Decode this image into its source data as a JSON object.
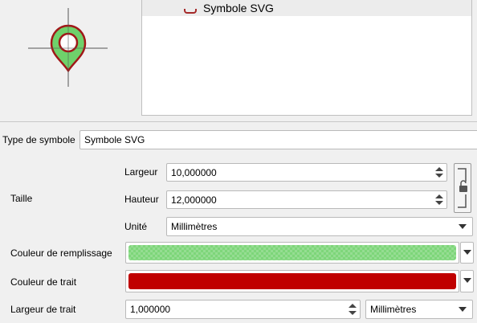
{
  "symbol_list": {
    "items": [
      {
        "label": "Symbole SVG"
      }
    ]
  },
  "form": {
    "symbol_type": {
      "label": "Type de symbole",
      "value": "Symbole SVG"
    },
    "size_group_label": "Taille",
    "width": {
      "label": "Largeur",
      "value": "10,000000"
    },
    "height": {
      "label": "Hauteur",
      "value": "12,000000"
    },
    "unit": {
      "label": "Unité",
      "value": "Millimètres"
    },
    "fill_color": {
      "label": "Couleur de remplissage",
      "color": "#7ed67a"
    },
    "stroke_color": {
      "label": "Couleur de trait",
      "color": "#c00000"
    },
    "stroke_width": {
      "label": "Largeur de trait",
      "value": "1,000000",
      "unit": "Millimètres"
    }
  },
  "icons": {
    "preview": "map-pin-icon",
    "lock": "lock-icon"
  }
}
